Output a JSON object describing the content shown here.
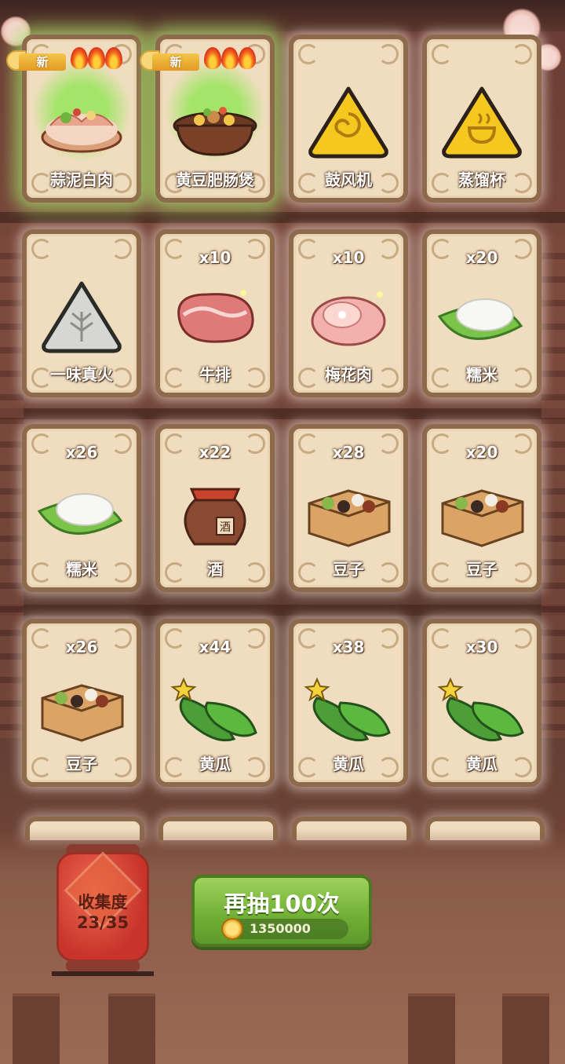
{
  "cards": [
    {
      "name": "蒜泥白肉",
      "count": "",
      "new": true,
      "badge": "新",
      "art": "dish-garlic-pork"
    },
    {
      "name": "黄豆肥肠煲",
      "count": "",
      "new": true,
      "badge": "新",
      "art": "dish-pot"
    },
    {
      "name": "鼓风机",
      "count": "",
      "new": false,
      "art": "yellow-triangle-swirl"
    },
    {
      "name": "蒸馏杯",
      "count": "",
      "new": false,
      "art": "yellow-triangle-cup"
    },
    {
      "name": "一味真火",
      "count": "",
      "new": false,
      "art": "grey-triangle"
    },
    {
      "name": "牛排",
      "count": "x10",
      "new": false,
      "art": "steak"
    },
    {
      "name": "梅花肉",
      "count": "x10",
      "new": false,
      "art": "pork-roll"
    },
    {
      "name": "糯米",
      "count": "x20",
      "new": false,
      "art": "rice-leaf"
    },
    {
      "name": "糯米",
      "count": "x26",
      "new": false,
      "art": "rice-leaf"
    },
    {
      "name": "酒",
      "count": "x22",
      "new": false,
      "art": "wine-jar"
    },
    {
      "name": "豆子",
      "count": "x28",
      "new": false,
      "art": "bean-box"
    },
    {
      "name": "豆子",
      "count": "x20",
      "new": false,
      "art": "bean-box"
    },
    {
      "name": "豆子",
      "count": "x26",
      "new": false,
      "art": "bean-box"
    },
    {
      "name": "黄瓜",
      "count": "x44",
      "new": false,
      "art": "cucumber"
    },
    {
      "name": "黄瓜",
      "count": "x38",
      "new": false,
      "art": "cucumber"
    },
    {
      "name": "黄瓜",
      "count": "x30",
      "new": false,
      "art": "cucumber"
    }
  ],
  "collection": {
    "label": "收集度",
    "value": "23/35"
  },
  "draw_button": {
    "label": "再抽100次",
    "cost": "1350000",
    "icon": "coin-icon"
  },
  "jar_char": "酒",
  "colors": {
    "card_bg": "#f0ddbf",
    "card_border": "#8c6a4b",
    "button_green": "#6fae34",
    "lantern_red": "#c8332a"
  }
}
